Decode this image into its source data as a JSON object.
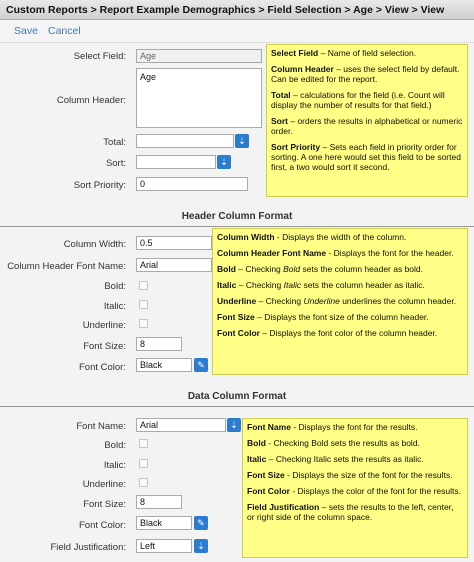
{
  "breadcrumb": "Custom Reports > Report Example Demographics > Field Selection > Age > View > View",
  "actions": {
    "save": "Save",
    "cancel": "Cancel"
  },
  "field": {
    "select_field_label": "Select Field:",
    "select_field_value": "Age",
    "column_header_label": "Column Header:",
    "column_header_value": "Age",
    "total_label": "Total:",
    "total_value": "",
    "sort_label": "Sort:",
    "sort_value": "",
    "sort_priority_label": "Sort Priority:",
    "sort_priority_value": "0"
  },
  "header_format": {
    "title": "Header Column Format",
    "column_width_label": "Column Width:",
    "column_width_value": "0.5",
    "font_name_label": "Column Header Font Name:",
    "font_name_value": "Arial",
    "bold_label": "Bold:",
    "italic_label": "Italic:",
    "underline_label": "Underline:",
    "font_size_label": "Font Size:",
    "font_size_value": "8",
    "font_color_label": "Font Color:",
    "font_color_value": "Black"
  },
  "data_format": {
    "title": "Data Column Format",
    "font_name_label": "Font Name:",
    "font_name_value": "Arial",
    "bold_label": "Bold:",
    "italic_label": "Italic:",
    "underline_label": "Underline:",
    "font_size_label": "Font Size:",
    "font_size_value": "8",
    "font_color_label": "Font Color:",
    "font_color_value": "Black",
    "justification_label": "Field Justification:",
    "justification_value": "Left"
  },
  "notes1": {
    "n1_term": "Select Field",
    "n1_text": " – Name of field selection.",
    "n2_term": "Column Header",
    "n2_text": " –  uses the select field by default. Can be edited for the report.",
    "n3_term": "Total",
    "n3_text": " – calculations for the field (i.e. Count will display the number of results for that field.)",
    "n4_term": "Sort",
    "n4_text": " – orders the results in alphabetical or numeric order.",
    "n5_term": "Sort Priority",
    "n5_text": " – Sets each field in priority order for sorting. A one here would set this field to be sorted first, a two would sort it second."
  },
  "notes2": {
    "n1_term": "Column Width",
    "n1_text": " -  Displays the width of the column.",
    "n2_term": "Column Header Font Name",
    "n2_text": " - Displays the font for the header.",
    "n3_term": "Bold",
    "n3_text_a": " – Checking ",
    "n3_em": "Bold",
    "n3_text_b": " sets the column header as bold.",
    "n4_term": "Italic",
    "n4_text_a": " – Checking ",
    "n4_em": "Italic",
    "n4_text_b": " sets the column header as italic.",
    "n5_term": "Underline",
    "n5_text_a": " – Checking ",
    "n5_em": "Underline",
    "n5_text_b": " underlines the column header.",
    "n6_term": "Font Size",
    "n6_text": " – Displays the font size of the column header.",
    "n7_term": "Font Color",
    "n7_text": " – Displays the font color of the column header."
  },
  "notes3": {
    "n1_term": "Font Name",
    "n1_text": " - Displays the font for the results.",
    "n2_term": "Bold",
    "n2_text": " - Checking Bold sets the results as bold.",
    "n3_term": "Italic",
    "n3_text": " – Checking Italic sets the results as italic.",
    "n4_term": "Font Size",
    "n4_text": " - Displays the size of the font for the results.",
    "n5_term": "Font Color",
    "n5_text": " - Displays the color of the font for the results.",
    "n6_term": "Field Justification",
    "n6_text": " – sets the results to the left, center, or right side of the column space."
  },
  "icons": {
    "dropdown": "dropdown-arrow-icon",
    "color_picker": "color-picker-icon"
  },
  "colors": {
    "note_bg": "#ffff88",
    "accent_blue": "#2b7bd1",
    "link_blue": "#3a7cc0"
  }
}
